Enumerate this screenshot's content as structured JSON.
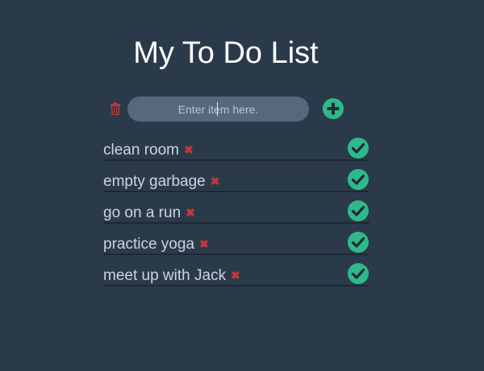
{
  "app": {
    "title": "My To Do List"
  },
  "entry": {
    "placeholder": "Enter item here.",
    "value": ""
  },
  "icons": {
    "trash": "trash-icon",
    "add": "plus-circle-icon",
    "delete": "x-icon",
    "complete": "check-circle-icon"
  },
  "colors": {
    "background": "#2b3a4a",
    "accent_green": "#2fb98a",
    "delete_red": "#c0393b",
    "input_bg": "#56697c"
  },
  "items": [
    {
      "label": "clean room"
    },
    {
      "label": "empty garbage"
    },
    {
      "label": "go on a run"
    },
    {
      "label": "practice yoga"
    },
    {
      "label": "meet up with Jack"
    }
  ]
}
